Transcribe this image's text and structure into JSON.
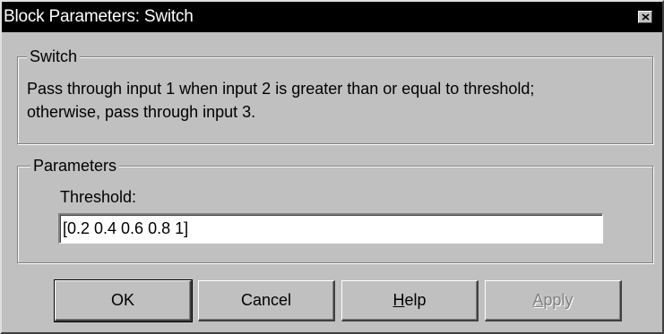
{
  "window": {
    "title": "Block Parameters: Switch"
  },
  "switch_group": {
    "legend": "Switch",
    "description_line1": "Pass through input 1 when input 2 is greater than or equal to threshold;",
    "description_line2": "otherwise, pass through input 3."
  },
  "parameters_group": {
    "legend": "Parameters",
    "threshold_label": "Threshold:",
    "threshold_value": "[0.2 0.4 0.6 0.8 1]"
  },
  "buttons": {
    "ok": "OK",
    "cancel": "Cancel",
    "help_accel": "H",
    "help_rest": "elp",
    "apply_accel": "A",
    "apply_rest": "pply"
  },
  "icons": {
    "close": "close-icon"
  }
}
